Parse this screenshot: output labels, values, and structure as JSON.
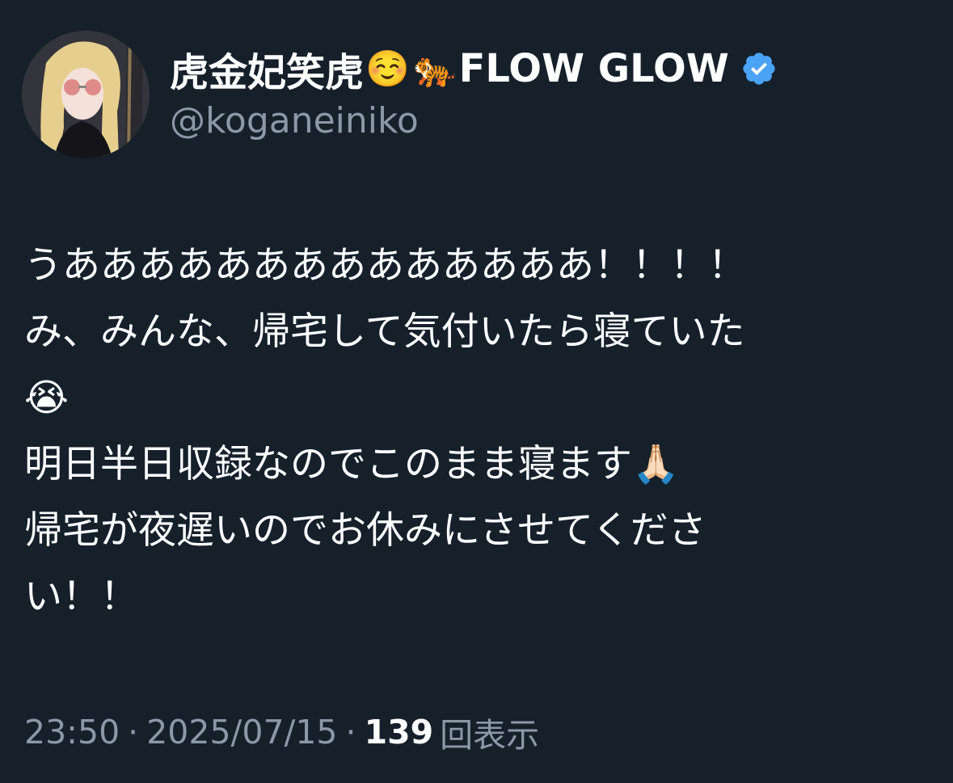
{
  "author": {
    "display_name": "虎金妃笑虎",
    "name_emoji_1": "☺️",
    "name_emoji_2": "🐅",
    "name_suffix": "FLOW GLOW",
    "handle": "@koganeiniko",
    "verified": true,
    "verified_color": "#4aa3f5"
  },
  "tweet": {
    "lines": [
      "うああああああああああああああ！！！！",
      "み、みんな、帰宅して気付いたら寝ていた",
      "😭",
      "明日半日収録なのでこのまま寝ます🙏🏻",
      "帰宅が夜遅いのでお休みにさせてくださ",
      "い！！"
    ],
    "time": "23:50",
    "date": "2025/07/15",
    "separator": "·",
    "views_count": "139",
    "views_label": "回表示"
  },
  "colors": {
    "background": "#15202b",
    "text_primary": "#ffffff",
    "text_secondary": "#8b98a5"
  }
}
